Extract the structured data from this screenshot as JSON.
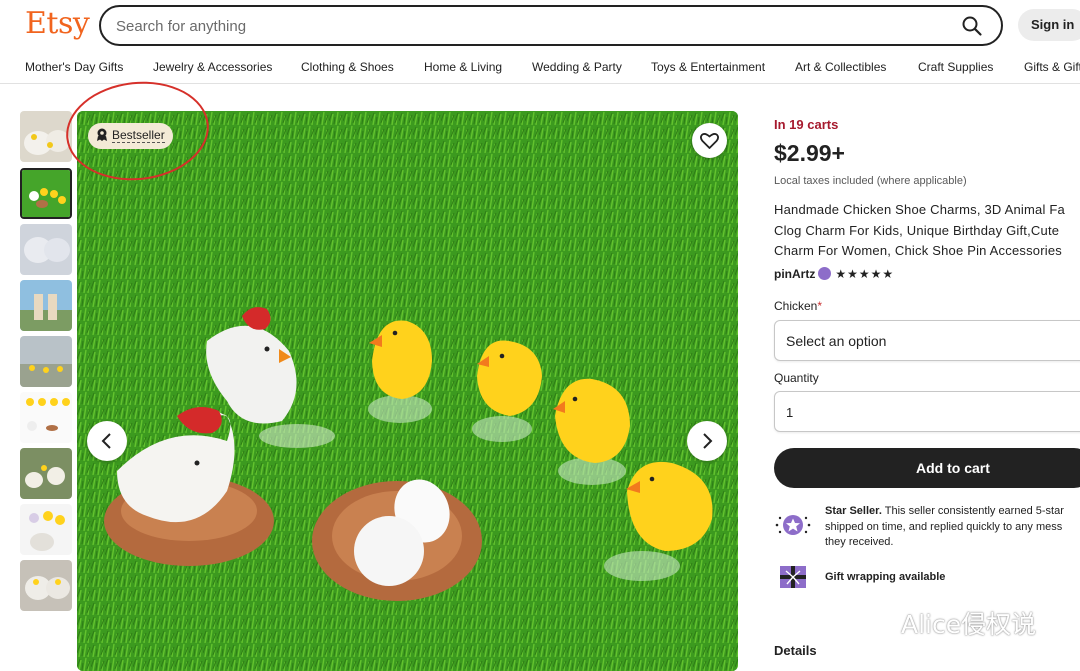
{
  "header": {
    "logo": "Etsy",
    "search": {
      "placeholder": "Search for anything",
      "icon": "search-icon"
    },
    "sign_in_label": "Sign in"
  },
  "categories": [
    "Mother's Day Gifts",
    "Jewelry & Accessories",
    "Clothing & Shoes",
    "Home & Living",
    "Wedding & Party",
    "Toys & Entertainment",
    "Art & Collectibles",
    "Craft Supplies",
    "Gifts & Gift Cards"
  ],
  "gallery": {
    "thumbnail_count": 9,
    "active_index": 1,
    "badge_label": "Bestseller",
    "favorite_icon": "heart-icon",
    "prev_icon": "chevron-left-icon",
    "next_icon": "chevron-right-icon"
  },
  "product": {
    "in_carts": "In 19 carts",
    "price": "$2.99+",
    "tax_note": "Local taxes included (where applicable)",
    "title_lines": [
      "Handmade Chicken Shoe Charms, 3D Animal Fa",
      "Clog Charm For Kids, Unique Birthday Gift,Cute",
      "Charm For Women, Chick Shoe Pin Accessories"
    ],
    "shop_name": "pinArtz",
    "rating_stars": "★★★★★",
    "option_label": "Chicken",
    "required_mark": "*",
    "option_placeholder": "Select an option",
    "quantity_label": "Quantity",
    "quantity_value": "1",
    "add_to_cart_label": "Add to cart",
    "star_seller_title": "Star Seller.",
    "star_seller_text_1": " This seller consistently earned 5-star",
    "star_seller_text_2": "shipped on time, and replied quickly to any mess",
    "star_seller_text_3": "they received.",
    "gift_wrap_text": "Gift wrapping available",
    "details_label": "Details"
  },
  "watermark": "Alice侵权说",
  "colors": {
    "brand": "#f1641e",
    "in_carts": "#a61a2e",
    "star_seller": "#8d6dc9",
    "annotation_circle": "#d6302a"
  }
}
